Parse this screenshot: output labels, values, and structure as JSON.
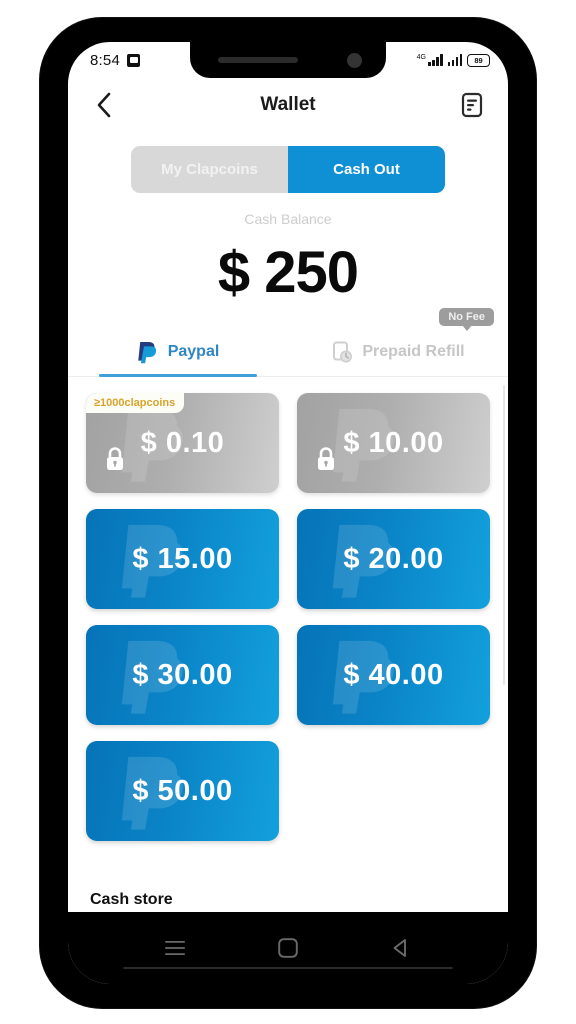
{
  "status_bar": {
    "time": "8:54",
    "network_label": "4G",
    "battery_level": "89",
    "notification_icon": "calendar-icon"
  },
  "header": {
    "title": "Wallet",
    "back_icon": "chevron-left-icon",
    "history_icon": "document-list-icon"
  },
  "segment": {
    "options": [
      {
        "label": "My Clapcoins",
        "active": false
      },
      {
        "label": "Cash Out",
        "active": true
      }
    ],
    "active_color": "#0f8fd4",
    "inactive_color": "#d8d8d8"
  },
  "balance": {
    "label": "Cash Balance",
    "amount": "$ 250"
  },
  "payment_tabs": [
    {
      "label": "Paypal",
      "icon": "paypal-logo-icon",
      "active": true,
      "badge": null
    },
    {
      "label": "Prepaid Refill",
      "icon": "prepaid-refill-icon",
      "active": false,
      "badge": "No Fee"
    }
  ],
  "amount_cards": [
    {
      "amount": "$ 0.10",
      "locked": true,
      "requirement": "≥1000clapcoins"
    },
    {
      "amount": "$ 10.00",
      "locked": true,
      "requirement": null
    },
    {
      "amount": "$ 15.00",
      "locked": false,
      "requirement": null
    },
    {
      "amount": "$ 20.00",
      "locked": false,
      "requirement": null
    },
    {
      "amount": "$ 30.00",
      "locked": false,
      "requirement": null
    },
    {
      "amount": "$ 40.00",
      "locked": false,
      "requirement": null
    },
    {
      "amount": "$ 50.00",
      "locked": false,
      "requirement": null
    }
  ],
  "section": {
    "cash_store_label": "Cash store"
  },
  "android_nav": {
    "recents_icon": "menu-lines-icon",
    "home_icon": "square-home-icon",
    "back_icon": "triangle-back-icon"
  },
  "colors": {
    "brand_blue": "#0f8fd4",
    "card_blue_dark": "#0673b8",
    "card_blue_light": "#13a0dd",
    "locked_gray": "#a2a2a2",
    "badge_gold": "#d9a22c",
    "paypal_text": "#2e87c2"
  }
}
